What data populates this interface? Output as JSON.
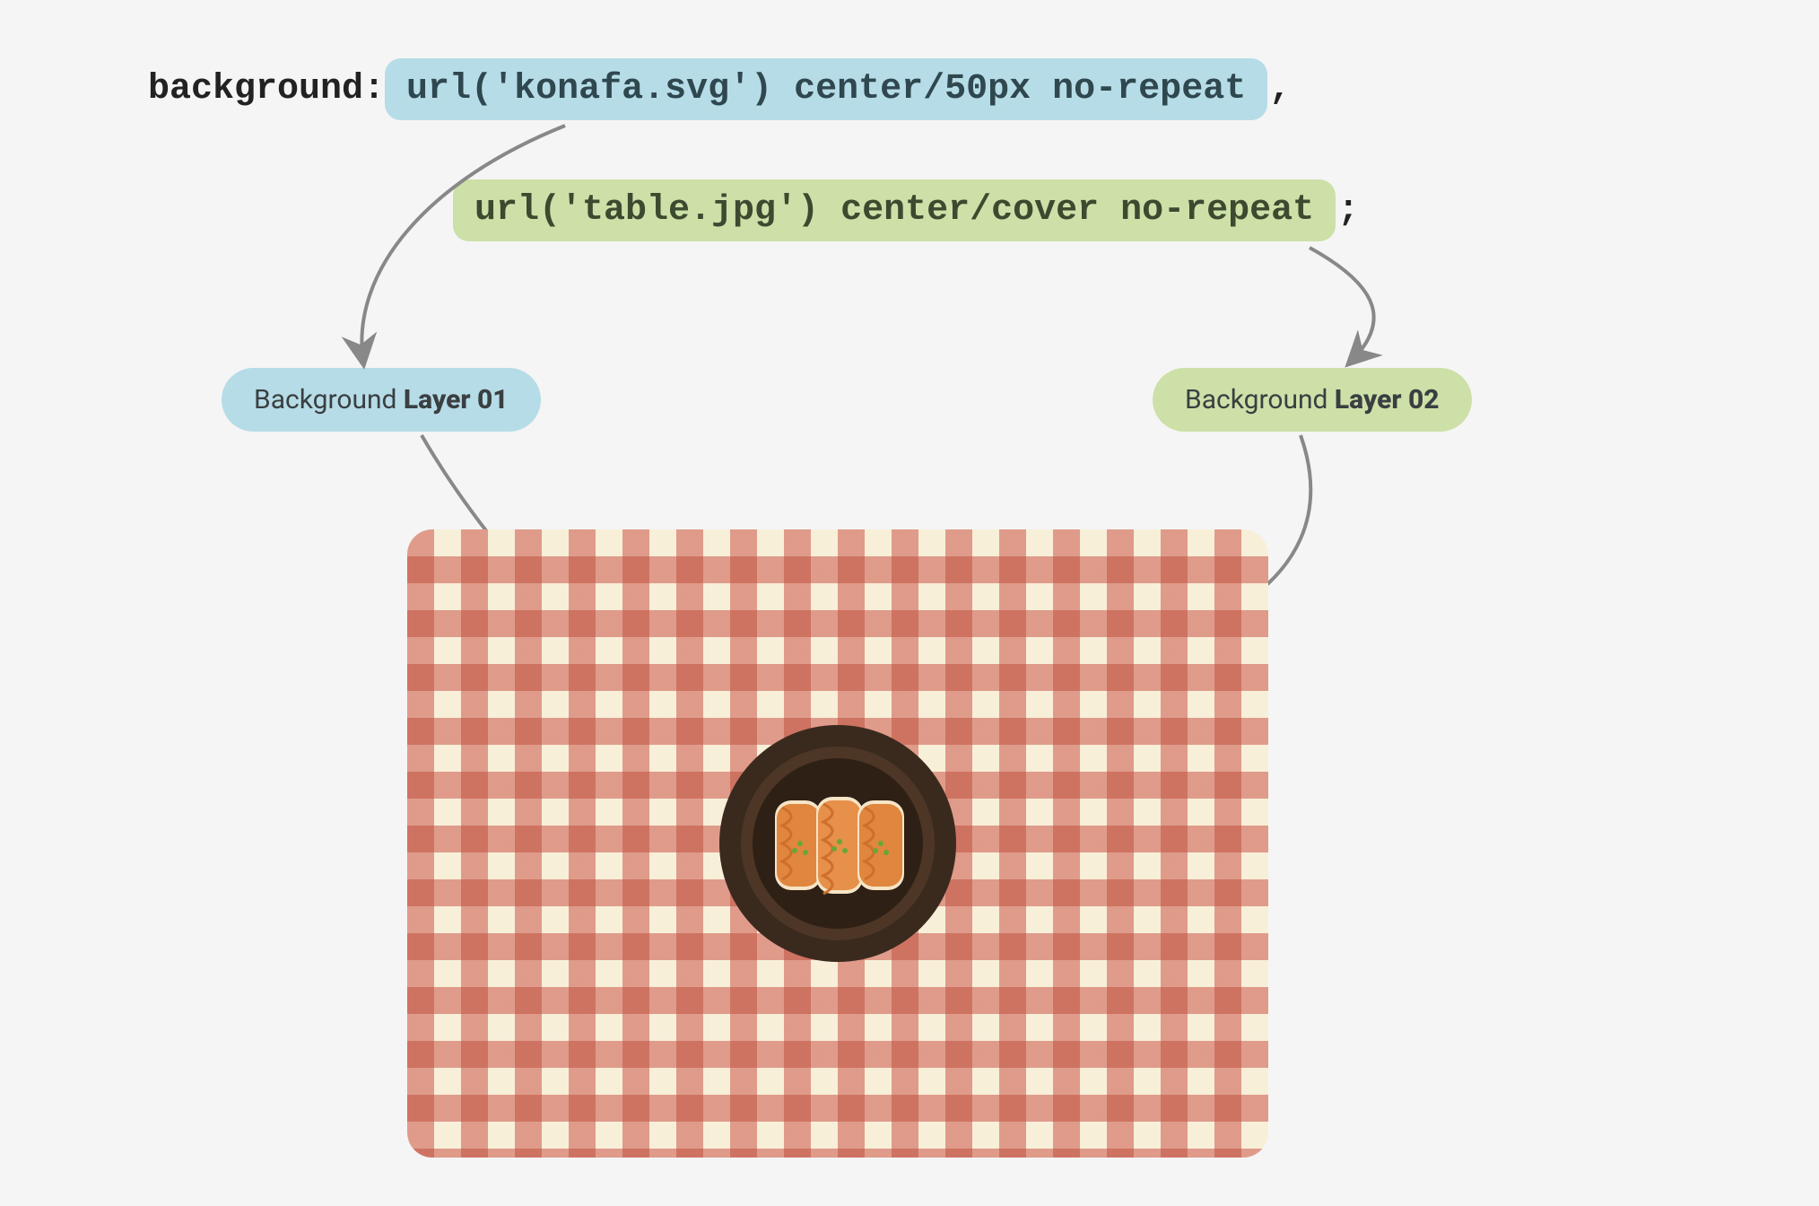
{
  "code": {
    "property": "background: ",
    "layer1": "url('konafa.svg') center/50px no-repeat",
    "sep": ",",
    "layer2": "url('table.jpg') center/cover no-repeat",
    "end": ";"
  },
  "labels": {
    "layer1_prefix": "Background ",
    "layer1_bold": "Layer 01",
    "layer2_prefix": "Background ",
    "layer2_bold": "Layer 02"
  }
}
